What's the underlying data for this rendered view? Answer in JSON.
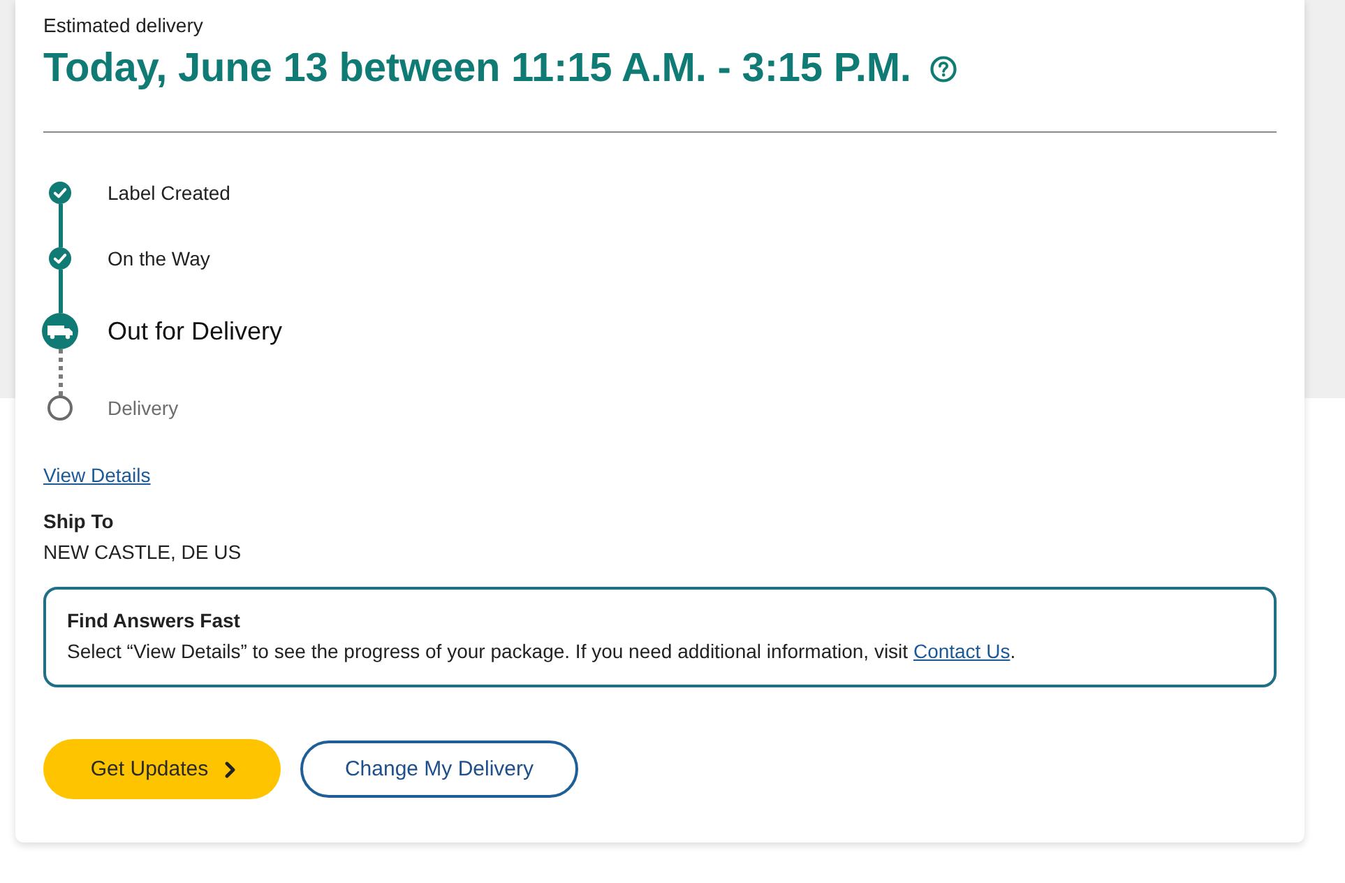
{
  "estimate": {
    "label": "Estimated delivery",
    "window": "Today, June 13 between 11:15 A.M. - 3:15 P.M."
  },
  "progress": [
    {
      "label": "Label Created",
      "kind": "done"
    },
    {
      "label": "On the Way",
      "kind": "done"
    },
    {
      "label": "Out for Delivery",
      "kind": "current"
    },
    {
      "label": "Delivery",
      "kind": "pending"
    }
  ],
  "details_link": "View Details",
  "ship_to": {
    "label": "Ship To",
    "address": "NEW CASTLE, DE US"
  },
  "notice": {
    "title": "Find Answers Fast",
    "text": "Select “View Details” to see the progress of your package. If you need additional information, visit ",
    "link": "Contact Us",
    "text_end": "."
  },
  "buttons": [
    {
      "label": "Get Updates",
      "kind": "primary"
    },
    {
      "label": "Change My Delivery",
      "kind": "outline"
    }
  ]
}
